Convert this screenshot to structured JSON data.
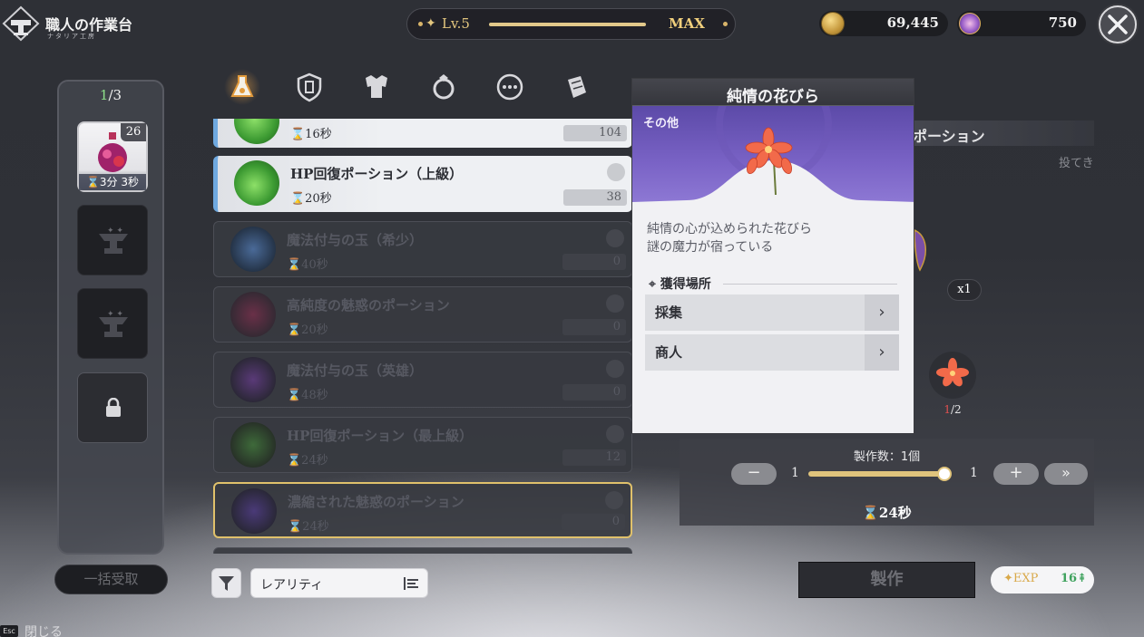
{
  "header": {
    "title": "職人の作業台",
    "title_sub": "ナタリア工房",
    "level": "Lv.5",
    "level_max": "MAX",
    "gold": "69,445",
    "gems": "750"
  },
  "queue": {
    "count_current": "1",
    "count_total": "/3",
    "slot1_badge": "26",
    "slot1_time": "⌛3分 3秒"
  },
  "tabs": [
    "potion",
    "shield",
    "armor",
    "accessory",
    "other",
    "material"
  ],
  "recipes": [
    {
      "name": "",
      "time": "⌛16秒",
      "count": "104",
      "state": "available"
    },
    {
      "name": "HP回復ポーション（上級）",
      "time": "⌛20秒",
      "count": "38",
      "state": "available"
    },
    {
      "name": "魔法付与の玉（希少）",
      "time": "⌛40秒",
      "count": "0",
      "state": "locked"
    },
    {
      "name": "高純度の魅惑のポーション",
      "time": "⌛20秒",
      "count": "0",
      "state": "locked"
    },
    {
      "name": "魔法付与の玉（英雄）",
      "time": "⌛48秒",
      "count": "0",
      "state": "locked"
    },
    {
      "name": "HP回復ポーション（最上級）",
      "time": "⌛24秒",
      "count": "12",
      "state": "locked"
    },
    {
      "name": "濃縮された魅惑のポーション",
      "time": "⌛24秒",
      "count": "0",
      "state": "selected"
    }
  ],
  "filter": {
    "rarity_label": "レアリティ"
  },
  "tooltip": {
    "title": "純情の花びら",
    "category": "その他",
    "desc_line1": "純情の心が込められた花びら",
    "desc_line2": "謎の魔力が宿っている",
    "source_heading": "獲得場所",
    "sources": [
      "採集",
      "商人"
    ]
  },
  "detail": {
    "title_fragment": "ポーション",
    "throw_label": "投てき",
    "yield": "x1",
    "material_have": "1",
    "material_need": "/2",
    "qty_label": "製作数：1個",
    "qty_min": "1",
    "qty_max": "1",
    "qty_fill": 1.0,
    "craft_time": "⌛24秒",
    "craft_button": "製作",
    "exp_label": "EXP",
    "exp_value": "16"
  },
  "footer": {
    "bulk_button": "一括受取",
    "esc_key": "Esc",
    "esc_label": "閉じる"
  },
  "colors": {
    "accent_gold": "#e0c47c",
    "tooltip_purple": "#7a63c6",
    "exp_green": "#3fa25e"
  }
}
